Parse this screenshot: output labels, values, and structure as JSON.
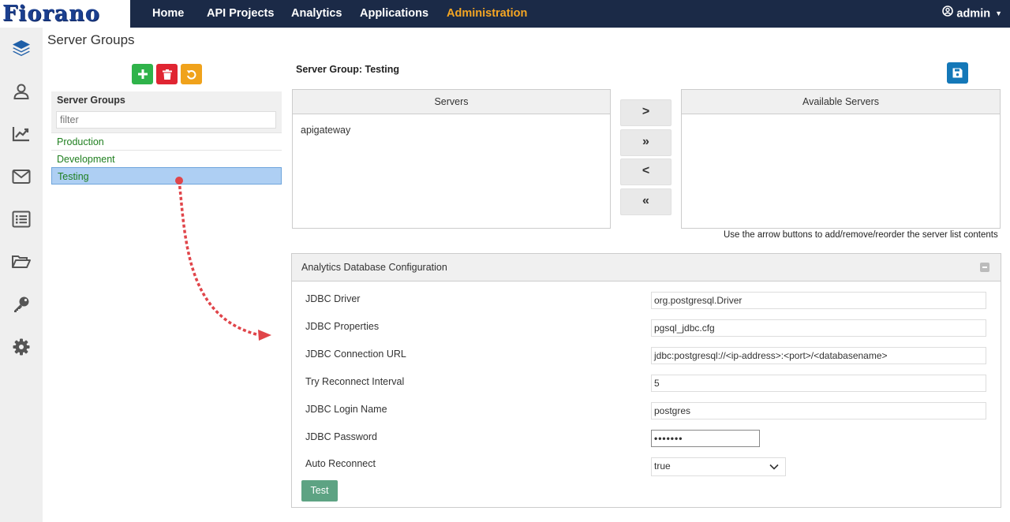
{
  "app": {
    "logo_text": "Fiorano"
  },
  "nav": {
    "items": [
      {
        "label": "Home"
      },
      {
        "label": "API Projects"
      },
      {
        "label": "Analytics"
      },
      {
        "label": "Applications"
      },
      {
        "label": "Administration",
        "active": true
      }
    ],
    "user": "admin"
  },
  "sidebar": {
    "icons": [
      "layers-icon",
      "user-icon",
      "chart-icon",
      "mail-icon",
      "list-icon",
      "folder-open-icon",
      "key-icon",
      "gear-icon"
    ]
  },
  "page": {
    "title": "Server Groups"
  },
  "groups": {
    "header": "Server Groups",
    "filter_placeholder": "filter",
    "items": [
      "Production",
      "Development",
      "Testing"
    ],
    "selected": "Testing"
  },
  "server_group": {
    "title": "Server Group: Testing",
    "servers_header": "Servers",
    "servers": [
      "apigateway"
    ],
    "available_header": "Available Servers",
    "available": [],
    "arrows": [
      ">",
      "»",
      "<",
      "«"
    ],
    "hint": "Use the arrow buttons to add/remove/reorder the server list contents"
  },
  "db_config": {
    "title": "Analytics Database Configuration",
    "fields": [
      {
        "label": "JDBC Driver",
        "value": "org.postgresql.Driver"
      },
      {
        "label": "JDBC Properties",
        "value": "pgsql_jdbc.cfg"
      },
      {
        "label": "JDBC Connection URL",
        "value": "jdbc:postgresql://<ip-address>:<port>/<databasename>"
      },
      {
        "label": "Try Reconnect Interval",
        "value": "5"
      },
      {
        "label": "JDBC Login Name",
        "value": "postgres"
      },
      {
        "label": "JDBC Password",
        "value": "•••••••"
      },
      {
        "label": "Auto Reconnect",
        "value": "true"
      }
    ],
    "test_label": "Test"
  },
  "colors": {
    "topbar": "#1b2a47",
    "active_nav": "#f5a623",
    "add": "#2fb34a",
    "delete": "#e02532",
    "reset": "#f0a21b",
    "save": "#1478b8",
    "test": "#5da383",
    "group_text": "#1f7f1f",
    "selection": "#aecff3",
    "annotation_arrow": "#e0454a"
  }
}
